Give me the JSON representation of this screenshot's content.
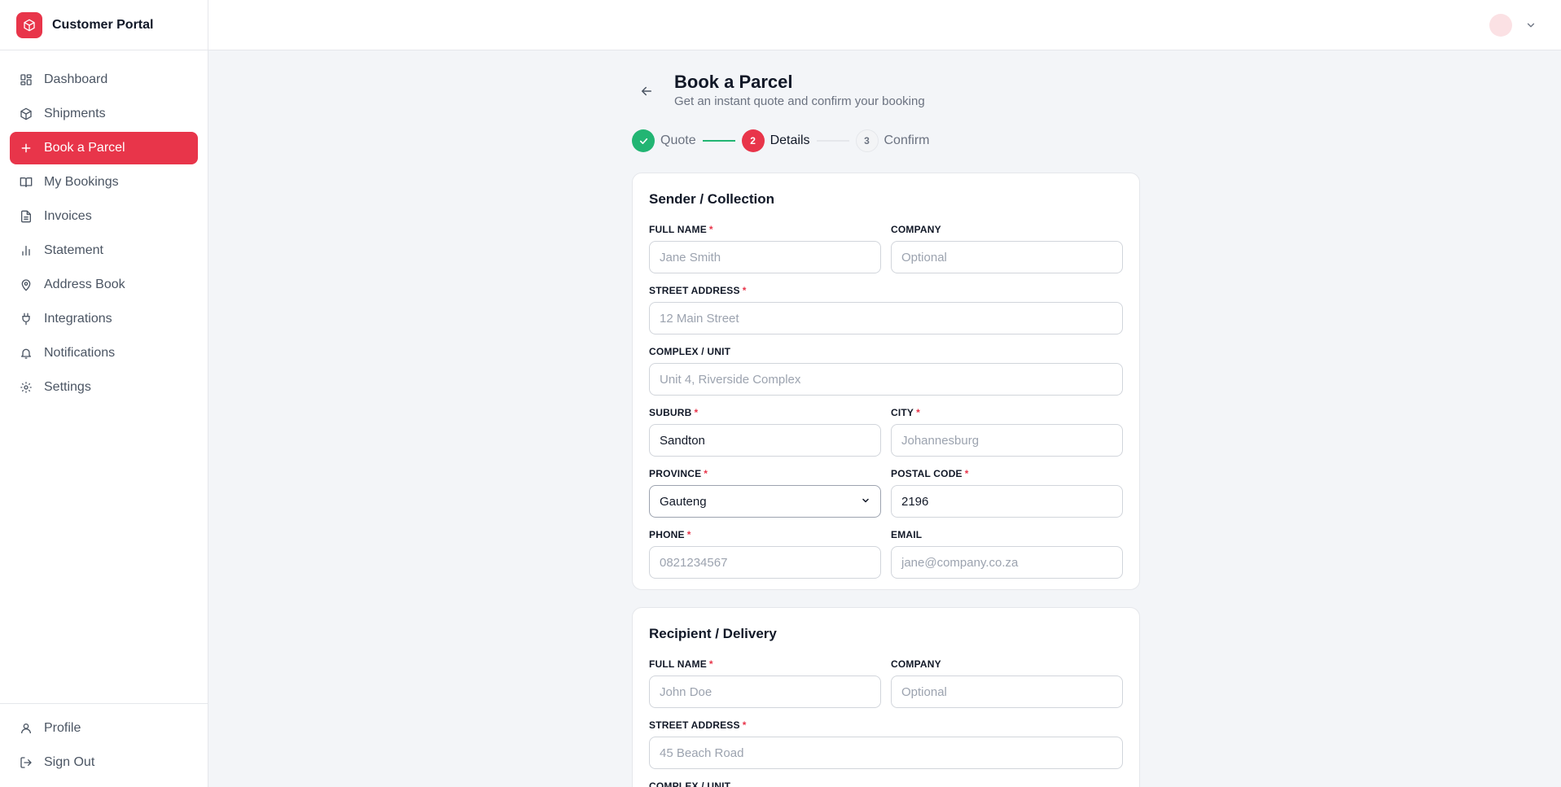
{
  "app": {
    "name": "Customer Portal"
  },
  "sidebar": {
    "items": [
      {
        "label": "Dashboard",
        "icon": "grid-icon"
      },
      {
        "label": "Shipments",
        "icon": "package-icon"
      },
      {
        "label": "Book a Parcel",
        "icon": "plus-icon",
        "active": true
      },
      {
        "label": "My Bookings",
        "icon": "book-open-icon"
      },
      {
        "label": "Invoices",
        "icon": "file-text-icon"
      },
      {
        "label": "Statement",
        "icon": "bar-chart-icon"
      },
      {
        "label": "Address Book",
        "icon": "map-pin-icon"
      },
      {
        "label": "Integrations",
        "icon": "plug-icon"
      },
      {
        "label": "Notifications",
        "icon": "bell-icon"
      },
      {
        "label": "Settings",
        "icon": "gear-icon"
      }
    ],
    "bottom": [
      {
        "label": "Profile",
        "icon": "user-icon"
      },
      {
        "label": "Sign Out",
        "icon": "logout-icon"
      }
    ]
  },
  "page": {
    "title": "Book a Parcel",
    "subtitle": "Get an instant quote and confirm your booking"
  },
  "stepper": {
    "steps": [
      {
        "number": "1",
        "label": "Quote",
        "state": "done"
      },
      {
        "number": "2",
        "label": "Details",
        "state": "active"
      },
      {
        "number": "3",
        "label": "Confirm",
        "state": "pending"
      }
    ]
  },
  "sender": {
    "title": "Sender / Collection",
    "full_name": {
      "label": "FULL NAME",
      "placeholder": "Jane Smith",
      "value": ""
    },
    "company": {
      "label": "COMPANY",
      "placeholder": "Optional",
      "value": ""
    },
    "street": {
      "label": "STREET ADDRESS",
      "placeholder": "12 Main Street",
      "value": ""
    },
    "complex": {
      "label": "COMPLEX / UNIT",
      "placeholder": "Unit 4, Riverside Complex",
      "value": ""
    },
    "suburb": {
      "label": "SUBURB",
      "placeholder": "",
      "value": "Sandton"
    },
    "city": {
      "label": "CITY",
      "placeholder": "Johannesburg",
      "value": ""
    },
    "province": {
      "label": "PROVINCE",
      "value": "Gauteng"
    },
    "postal_code": {
      "label": "POSTAL CODE",
      "placeholder": "",
      "value": "2196"
    },
    "phone": {
      "label": "PHONE",
      "placeholder": "0821234567",
      "value": ""
    },
    "email": {
      "label": "EMAIL",
      "placeholder": "jane@company.co.za",
      "value": ""
    }
  },
  "recipient": {
    "title": "Recipient / Delivery",
    "full_name": {
      "label": "FULL NAME",
      "placeholder": "John Doe",
      "value": ""
    },
    "company": {
      "label": "COMPANY",
      "placeholder": "Optional",
      "value": ""
    },
    "street": {
      "label": "STREET ADDRESS",
      "placeholder": "45 Beach Road",
      "value": ""
    },
    "complex": {
      "label": "COMPLEX / UNIT"
    }
  },
  "required_marker": "*",
  "colors": {
    "accent": "#e8354a",
    "success": "#22b573",
    "avatar_bg": "#fbe1e4"
  }
}
